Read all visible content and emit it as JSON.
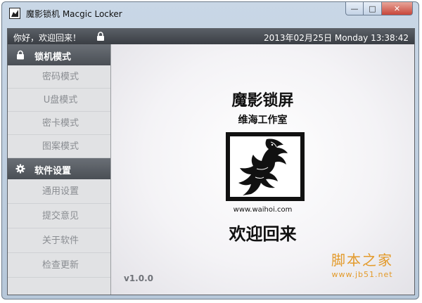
{
  "window": {
    "title": "魔影锁机 Macgic Locker",
    "min_label": "—",
    "max_label": "□",
    "close_label": "✕"
  },
  "topbar": {
    "greeting": "你好，欢迎回来！",
    "datetime": "2013年02月25日 Monday 13:38:42"
  },
  "sidebar": {
    "sections": [
      {
        "title": "锁机模式",
        "icon": "lock-icon",
        "items": [
          "密码模式",
          "U盘模式",
          "密卡模式",
          "图案模式"
        ]
      },
      {
        "title": "软件设置",
        "icon": "gear-icon",
        "items": [
          "通用设置",
          "提交意见",
          "关于软件",
          "检查更新"
        ]
      }
    ]
  },
  "main": {
    "title": "魔影锁屏",
    "studio": "维海工作室",
    "url": "www.waihoi.com",
    "welcome": "欢迎回来",
    "version": "v1.0.0"
  },
  "watermark": {
    "text": "脚本之家",
    "url": "www.jb51.net"
  },
  "colors": {
    "topbar_bg": "#45494f",
    "sidebar_bg": "#e1e2e4",
    "watermark": "#e39a2a"
  }
}
